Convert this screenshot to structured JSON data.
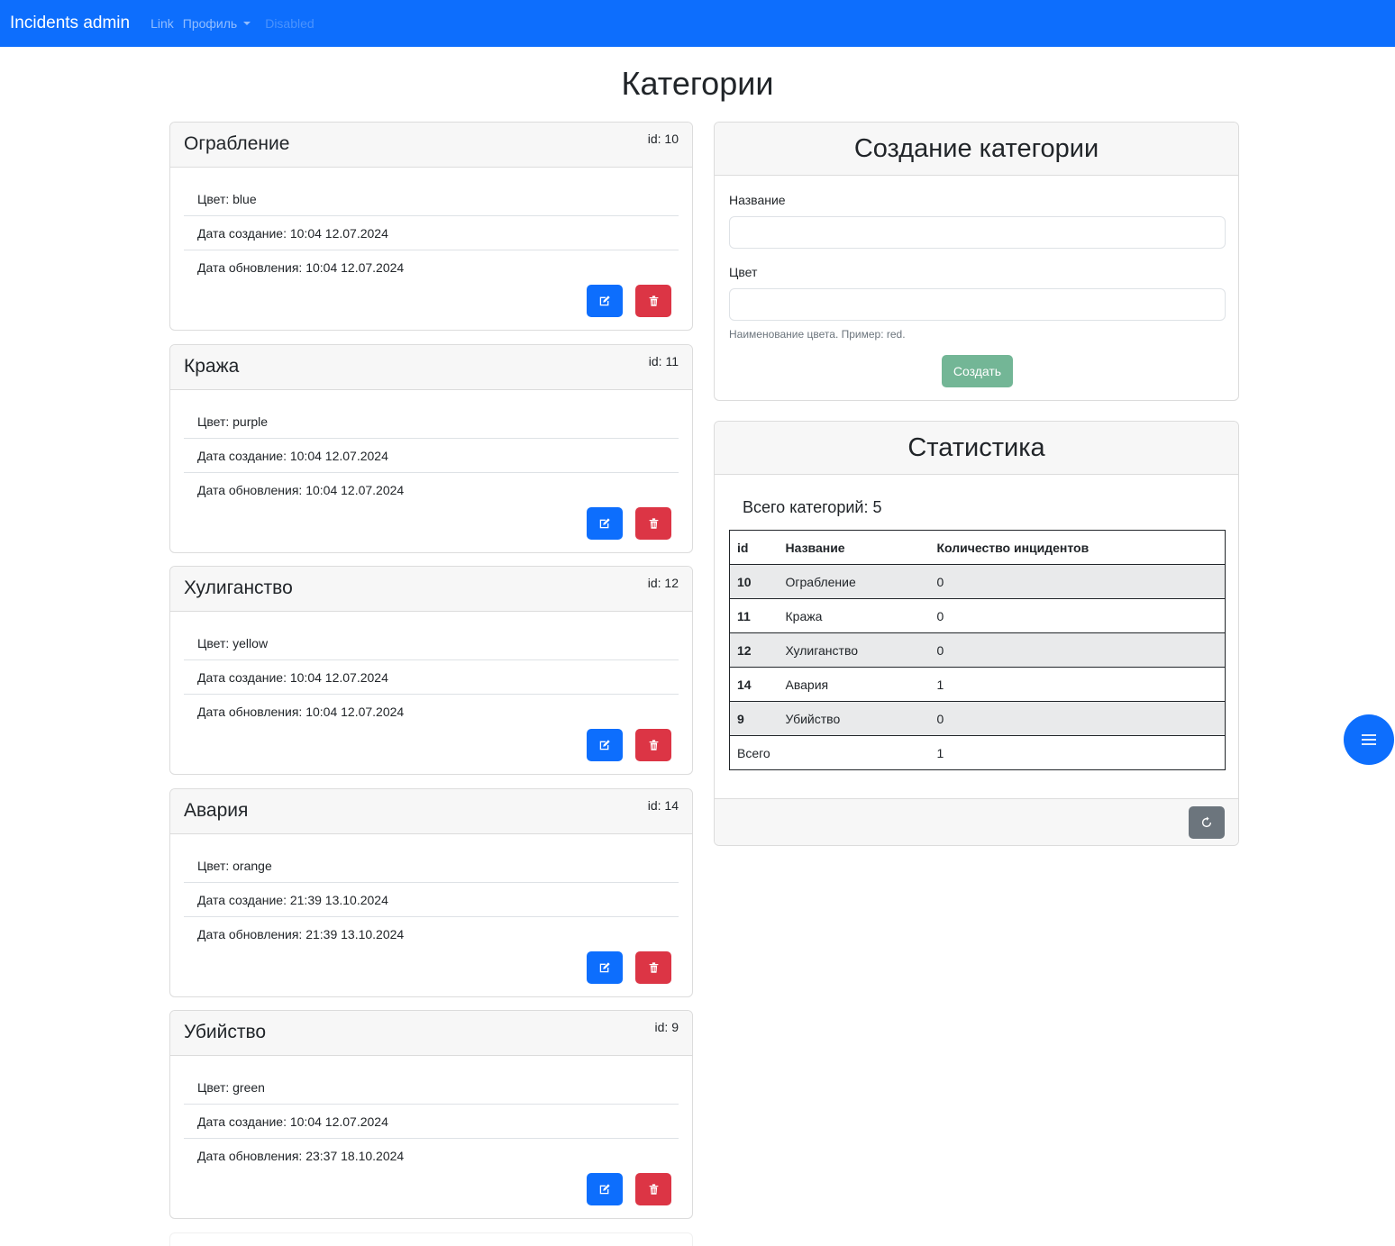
{
  "navbar": {
    "brand": "Incidents admin",
    "link": "Link",
    "profile": "Профиль",
    "disabled": "Disabled",
    "bg_color": "#0d6efd"
  },
  "page": {
    "title": "Категории"
  },
  "categories": [
    {
      "title": "Ограбление",
      "id_label": "id: 10",
      "color": "Цвет: blue",
      "created": "Дата создание: 10:04 12.07.2024",
      "updated": "Дата обновления: 10:04 12.07.2024"
    },
    {
      "title": "Кража",
      "id_label": "id: 11",
      "color": "Цвет: purple",
      "created": "Дата создание: 10:04 12.07.2024",
      "updated": "Дата обновления: 10:04 12.07.2024"
    },
    {
      "title": "Хулиганство",
      "id_label": "id: 12",
      "color": "Цвет: yellow",
      "created": "Дата создание: 10:04 12.07.2024",
      "updated": "Дата обновления: 10:04 12.07.2024"
    },
    {
      "title": "Авария",
      "id_label": "id: 14",
      "color": "Цвет: orange",
      "created": "Дата создание: 21:39 13.10.2024",
      "updated": "Дата обновления: 21:39 13.10.2024"
    },
    {
      "title": "Убийство",
      "id_label": "id: 9",
      "color": "Цвет: green",
      "created": "Дата создание: 10:04 12.07.2024",
      "updated": "Дата обновления: 23:37 18.10.2024"
    }
  ],
  "create_form": {
    "title": "Создание категории",
    "name_label": "Название",
    "name_value": "",
    "color_label": "Цвет",
    "color_value": "",
    "color_hint": "Наименование цвета. Пример: red.",
    "submit": "Создать"
  },
  "stats": {
    "title": "Статистика",
    "total_label": "Всего категорий: 5",
    "columns": [
      "id",
      "Название",
      "Количество инцидентов"
    ],
    "rows": [
      {
        "id": "10",
        "name": "Ограбление",
        "count": "0"
      },
      {
        "id": "11",
        "name": "Кража",
        "count": "0"
      },
      {
        "id": "12",
        "name": "Хулиганство",
        "count": "0"
      },
      {
        "id": "14",
        "name": "Авария",
        "count": "1"
      },
      {
        "id": "9",
        "name": "Убийство",
        "count": "0"
      }
    ],
    "total_row": {
      "label": "Всего",
      "count": "1"
    }
  },
  "icons": {
    "edit": "edit-icon",
    "delete": "trash-icon",
    "refresh": "refresh-icon",
    "fab": "menu-icon"
  }
}
